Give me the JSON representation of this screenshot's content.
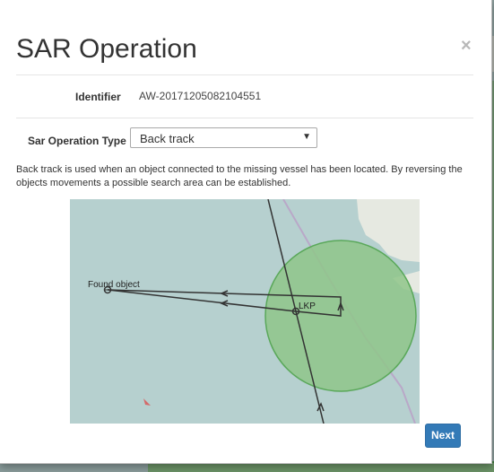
{
  "modal": {
    "title": "SAR Operation",
    "close_label": "×"
  },
  "identifier": {
    "label": "Identifier",
    "value": "AW-20171205082104551"
  },
  "operation_type": {
    "label": "Sar Operation Type",
    "selected": "Back track"
  },
  "description": "Back track is used when an object connected to the missing vessel has been located. By reversing the objects movements a possible search area can be established.",
  "map": {
    "found_object_label": "Found object",
    "lkp_label": "LKP",
    "colors": {
      "water": "#b6d0cf",
      "land": "#e6e9e1",
      "search_area_fill": "#8fc58a",
      "search_area_stroke": "#5aa85a",
      "track_line": "#333333",
      "route_line": "#b9a8c8"
    }
  },
  "footer": {
    "next_label": "Next"
  }
}
